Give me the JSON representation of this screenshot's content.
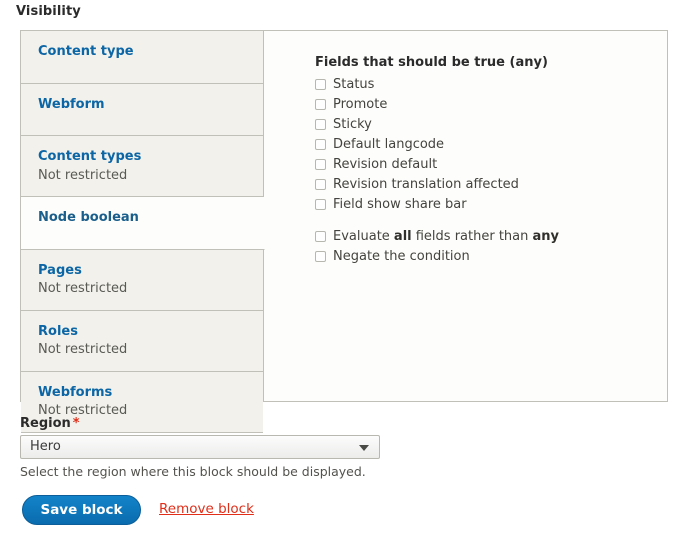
{
  "visibility": {
    "legend": "Visibility",
    "tabs": [
      {
        "title": "Content type",
        "summary": ""
      },
      {
        "title": "Webform",
        "summary": ""
      },
      {
        "title": "Content types",
        "summary": "Not restricted"
      },
      {
        "title": "Node boolean",
        "summary": "",
        "selected": true
      },
      {
        "title": "Pages",
        "summary": "Not restricted"
      },
      {
        "title": "Roles",
        "summary": "Not restricted"
      },
      {
        "title": "Webforms",
        "summary": "Not restricted"
      }
    ],
    "pane": {
      "legend": "Fields that should be true (any)",
      "fields": [
        {
          "label": "Status",
          "checked": false
        },
        {
          "label": "Promote",
          "checked": false
        },
        {
          "label": "Sticky",
          "checked": false
        },
        {
          "label": "Default langcode",
          "checked": false
        },
        {
          "label": "Revision default",
          "checked": false
        },
        {
          "label": "Revision translation affected",
          "checked": false
        },
        {
          "label": "Field show share bar",
          "checked": false
        }
      ],
      "evaluate_all": {
        "prefix": "Evaluate ",
        "strong1": "all",
        "middle": " fields rather than ",
        "strong2": "any",
        "checked": false
      },
      "negate": {
        "label": "Negate the condition",
        "checked": false
      }
    }
  },
  "region": {
    "label": "Region",
    "required_marker": "*",
    "value": "Hero",
    "description": "Select the region where this block should be displayed."
  },
  "actions": {
    "save_label": "Save block",
    "remove_label": "Remove block"
  },
  "colors": {
    "link_blue": "#0c66a5",
    "danger_red": "#e02e19",
    "button_blue": "#0a6cae",
    "panel_bg": "#fdfdfb",
    "tab_bg": "#f2f1ec",
    "border": "#c0c0b8"
  }
}
